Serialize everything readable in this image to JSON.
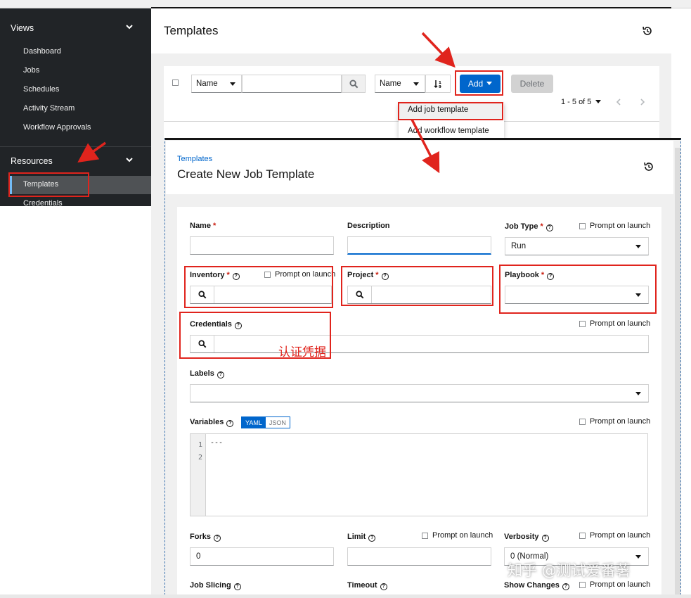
{
  "sidebar": {
    "views_label": "Views",
    "views_items": [
      "Dashboard",
      "Jobs",
      "Schedules",
      "Activity Stream",
      "Workflow Approvals"
    ],
    "resources_label": "Resources",
    "resources_items": [
      "Templates",
      "Credentials"
    ]
  },
  "page": {
    "title": "Templates"
  },
  "toolbar": {
    "filter_select": "Name",
    "sort_select": "Name",
    "add_label": "Add",
    "delete_label": "Delete",
    "pagination": "1 - 5 of 5"
  },
  "add_menu": {
    "items": [
      "Add job template",
      "Add workflow template"
    ]
  },
  "form": {
    "breadcrumb": "Templates",
    "title": "Create New Job Template",
    "name_label": "Name",
    "description_label": "Description",
    "job_type_label": "Job Type",
    "job_type_value": "Run",
    "inventory_label": "Inventory",
    "project_label": "Project",
    "playbook_label": "Playbook",
    "credentials_label": "Credentials",
    "labels_label": "Labels",
    "variables_label": "Variables",
    "yaml_label": "YAML",
    "json_label": "JSON",
    "editor_lines": [
      "1",
      "2"
    ],
    "editor_content": "---",
    "forks_label": "Forks",
    "forks_value": "0",
    "limit_label": "Limit",
    "verbosity_label": "Verbosity",
    "verbosity_value": "0 (Normal)",
    "job_slicing_label": "Job Slicing",
    "timeout_label": "Timeout",
    "show_changes_label": "Show Changes",
    "prompt_on_launch": "Prompt on launch",
    "required_mark": "*",
    "help_mark": "?"
  },
  "annotation_text": "认证凭据",
  "watermark": "知乎 @测试爱番薯",
  "colors": {
    "sidebar_bg": "#212427",
    "primary": "#0066cc",
    "annotation_red": "#e0241d"
  }
}
